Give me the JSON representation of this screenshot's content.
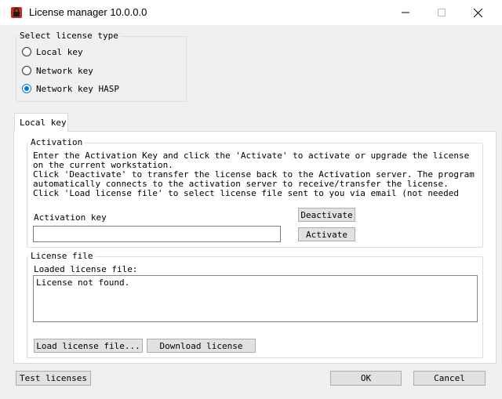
{
  "window": {
    "title": "License manager 10.0.0.0",
    "icon": "lock-icon"
  },
  "license_type": {
    "label": "Select license type",
    "options": [
      "Local key",
      "Network key",
      "Network key HASP"
    ],
    "selected": "Network key HASP"
  },
  "tabs": [
    {
      "label": "Local key",
      "active": true
    }
  ],
  "activation": {
    "group_label": "Activation",
    "description_lines": [
      "Enter the Activation Key and click the 'Activate' to activate or upgrade the license on the current workstation.",
      "Click 'Deactivate' to transfer the license back to the Activation server. The program automatically connects to the activation server to receive/transfer the license.",
      "Click 'Load license file' to select license file sent to you via email (not needed for trial license)."
    ],
    "key_label": "Activation key",
    "key_value": "",
    "deactivate_label": "Deactivate",
    "activate_label": "Activate"
  },
  "license_file": {
    "group_label": "License file",
    "loaded_label": "Loaded license file:",
    "content": "License not found.",
    "load_button": "Load license file...",
    "download_button": "Download license"
  },
  "footer": {
    "test_button": "Test licenses",
    "ok_button": "OK",
    "cancel_button": "Cancel"
  },
  "colors": {
    "accent": "#0078d7",
    "window_bg": "#f0f0f0",
    "panel_bg": "#ffffff",
    "icon_red": "#c42b1c"
  }
}
